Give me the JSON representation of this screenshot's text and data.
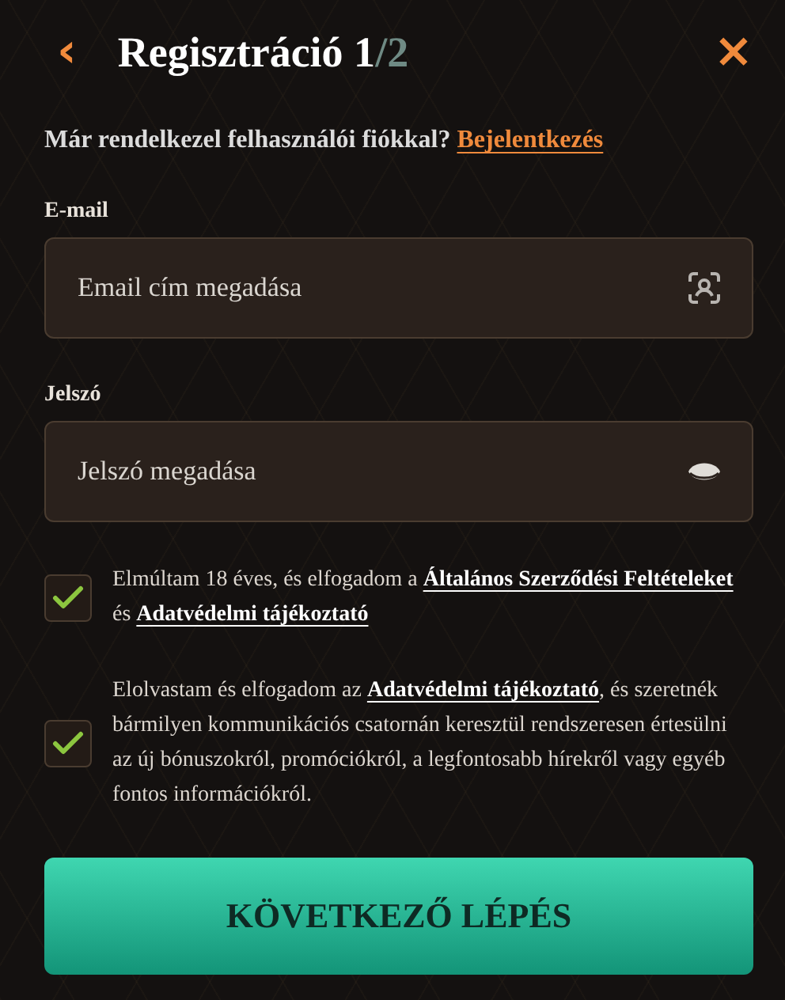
{
  "header": {
    "back": "‹",
    "title": "Regisztráció 1",
    "step_total": "/2",
    "close": "×"
  },
  "login_prompt": {
    "text": "Már rendelkezel felhasználói fiókkal? ",
    "link": "Bejelentkezés"
  },
  "fields": [
    {
      "kind": "email",
      "label": "E-mail",
      "placeholder": "Email cím megadása"
    },
    {
      "kind": "password",
      "label": "Jelszó",
      "placeholder": "Jelszó megadása"
    }
  ],
  "consents": [
    {
      "checked": true,
      "parts": [
        {
          "text": "Elmúltam 18 éves, és elfogadom a "
        },
        {
          "link": "Általános Szerződési Feltételeket"
        },
        {
          "text": " és "
        },
        {
          "link": "Adatvédelmi tájékoztató"
        }
      ]
    },
    {
      "checked": true,
      "parts": [
        {
          "text": "Elolvastam és elfogadom az "
        },
        {
          "link": "Adatvédelmi tájékoztató"
        },
        {
          "text": ", és szeretnék bármilyen kommunikációs csatornán keresztül rendszeresen értesülni az új bónuszokról, promóciókról, a legfontosabb hírekről vagy egyéb fontos információkról."
        }
      ]
    }
  ],
  "submit": "KÖVETKEZŐ LÉPÉS"
}
